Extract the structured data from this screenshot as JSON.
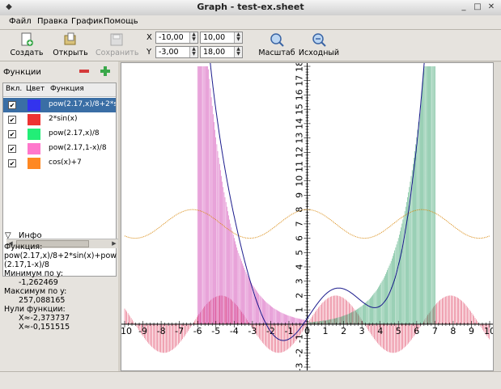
{
  "window": {
    "title": "Graph - test-ex.sheet"
  },
  "menu": [
    "Файл",
    "Правка",
    "График",
    "Помощь"
  ],
  "toolbar": {
    "create": "Создать",
    "open": "Открыть",
    "save": "Сохранить",
    "zoom": "Масштаб",
    "home": "Исходный"
  },
  "axes_range": {
    "x_label": "X",
    "y_label": "Y",
    "x_min": "-10,00",
    "x_max": "10,00",
    "y_min": "-3,00",
    "y_max": "18,00"
  },
  "functions_panel": {
    "title": "Функции",
    "columns": [
      "Вкл.",
      "Цвет",
      "Функция"
    ],
    "items": [
      {
        "enabled": true,
        "color": "#3333ee",
        "label": "pow(2.17,x)/8+2*sin(x)+pow(2.17,1-x)/8",
        "selected": true
      },
      {
        "enabled": true,
        "color": "#ee3333",
        "label": "2*sin(x)",
        "selected": false
      },
      {
        "enabled": true,
        "color": "#22ee77",
        "label": "pow(2.17,x)/8",
        "selected": false
      },
      {
        "enabled": true,
        "color": "#ff77cc",
        "label": "pow(2.17,1-x)/8",
        "selected": false
      },
      {
        "enabled": true,
        "color": "#ff8822",
        "label": "cos(x)+7",
        "selected": false
      }
    ]
  },
  "info": {
    "title": "Инфо",
    "function_label": "Функция:",
    "function_text": "pow(2.17,x)/8+2*sin(x)+pow(2.17,1-x)/8",
    "min_label": "Минимум по y:",
    "min_value": "-1,262469",
    "max_label": "Максимум по y:",
    "max_value": "257,088165",
    "zeros_label": "Нули функции:",
    "zero1": "X≈-2,373737",
    "zero2": "X≈-0,151515"
  },
  "plot": {
    "x_ticks": [
      "-10",
      "-9",
      "-8",
      "-7",
      "-6",
      "-5",
      "-4",
      "-3",
      "-2",
      "-1",
      "0",
      "1",
      "2",
      "3",
      "4",
      "5",
      "6",
      "7",
      "8",
      "9",
      "10"
    ],
    "y_ticks": [
      "-3",
      "-2",
      "-1",
      "1",
      "2",
      "3",
      "4",
      "5",
      "6",
      "7",
      "8",
      "9",
      "10",
      "11",
      "12",
      "13",
      "14",
      "15",
      "16",
      "17",
      "18"
    ],
    "colors": {
      "sum": "#1a1a8c",
      "sin": "#e04060",
      "exp": "#2e9e66",
      "exp_neg": "#d040b0",
      "cos": "#d98a10"
    }
  }
}
